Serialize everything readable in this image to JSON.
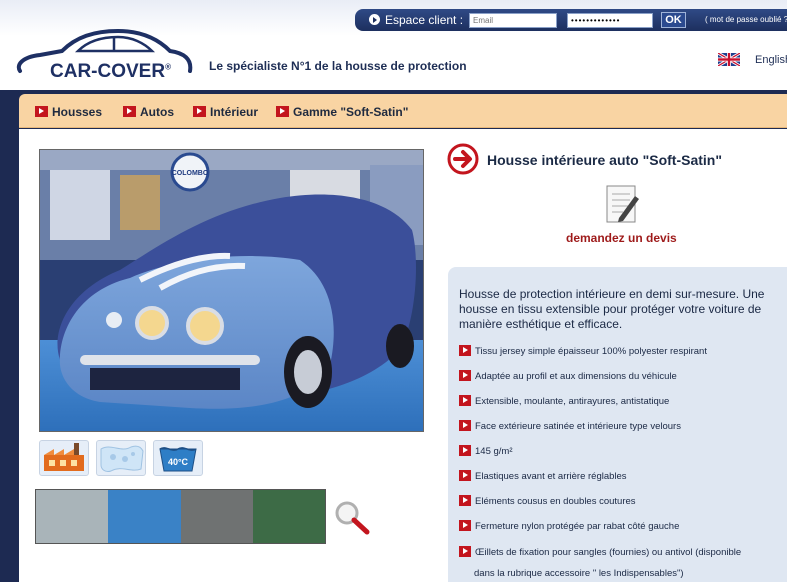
{
  "header": {
    "espace_label": "Espace client :",
    "email_placeholder": "Email",
    "password_mask": "•••••••••••••",
    "ok_label": "OK",
    "forgot_label": "( mot de passe oublié ?",
    "logo_text": "CAR-COVER",
    "tagline": "Le spécialiste N°1 de la housse de protection",
    "lang_label": "English"
  },
  "nav": {
    "items": [
      {
        "label": "Housses"
      },
      {
        "label": "Autos"
      },
      {
        "label": "Intérieur"
      },
      {
        "label": "Gamme \"Soft-Satin\""
      }
    ]
  },
  "product": {
    "title": "Housse intérieure auto \"Soft-Satin\"",
    "quote_label": "demandez un devis",
    "intro": "Housse de protection intérieure en demi sur-mesure. Une housse en tissu extensible pour protéger votre voiture de manière esthétique et efficace.",
    "features": [
      "Tissu jersey simple épaisseur 100% polyester respirant",
      "Adaptée au profil et aux dimensions du véhicule",
      "Extensible, moulante, antirayures, antistatique",
      "Face extérieure satinée et intérieure type velours",
      "145 g/m²",
      "Elastiques avant et arrière réglables",
      "Eléments cousus en doubles coutures",
      "Fermeture nylon protégée par rabat côté gauche",
      "Œillets de fixation pour sangles (fournies) ou antivol (disponible"
    ],
    "feature_continuation": "dans la rubrique accessoire \" les Indispensables\")",
    "photo_sign": "COLOMBO",
    "wash_label": "40°C"
  },
  "colors": {
    "accent_red": "#c3151e",
    "nav_bg": "#f9d4a3",
    "dark_navy": "#1d2a52",
    "panel_bg": "#dfe7f2"
  },
  "swatches": [
    {
      "name": "grey",
      "color": "#a9b4b9"
    },
    {
      "name": "blue",
      "color": "#3a82c6"
    },
    {
      "name": "anthracite",
      "color": "#6f7272"
    },
    {
      "name": "green",
      "color": "#3d6b46"
    }
  ],
  "icons": [
    "arrow-right-icon",
    "uk-flag-icon",
    "factory-icon",
    "fabric-icon",
    "wash-40-icon",
    "magnifier-icon",
    "notepad-pencil-icon"
  ]
}
